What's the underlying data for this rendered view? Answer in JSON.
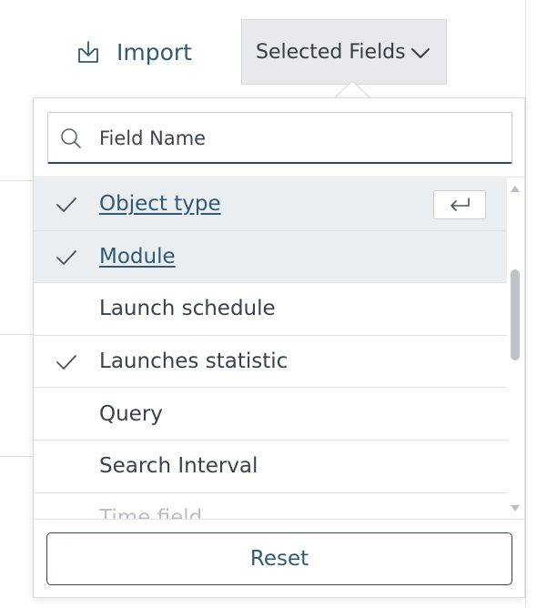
{
  "toolbar": {
    "import_label": "Import",
    "import_icon": "download-tray-icon",
    "selected_fields_label": "Selected Fields",
    "selected_fields_icon": "chevron-down-icon"
  },
  "field_picker": {
    "search": {
      "placeholder": "Field Name",
      "value": "",
      "icon": "search-icon"
    },
    "items": [
      {
        "label": "Object type",
        "checked": true,
        "highlighted": true,
        "enter_hint_icon": "enter-key-icon"
      },
      {
        "label": "Module",
        "checked": true,
        "highlighted": true
      },
      {
        "label": "Launch schedule",
        "checked": false,
        "highlighted": false
      },
      {
        "label": "Launches statistic",
        "checked": true,
        "highlighted": false
      },
      {
        "label": "Query",
        "checked": false,
        "highlighted": false
      },
      {
        "label": "Search Interval",
        "checked": false,
        "highlighted": false
      },
      {
        "label": "Time field",
        "checked": false,
        "highlighted": false,
        "partially_visible": true
      }
    ],
    "reset_label": "Reset"
  },
  "colors": {
    "accent": "#2f5977",
    "border_dark": "#2f4b63",
    "highlight_row": "#eaeef1",
    "button_bg": "#e7e9ec"
  }
}
